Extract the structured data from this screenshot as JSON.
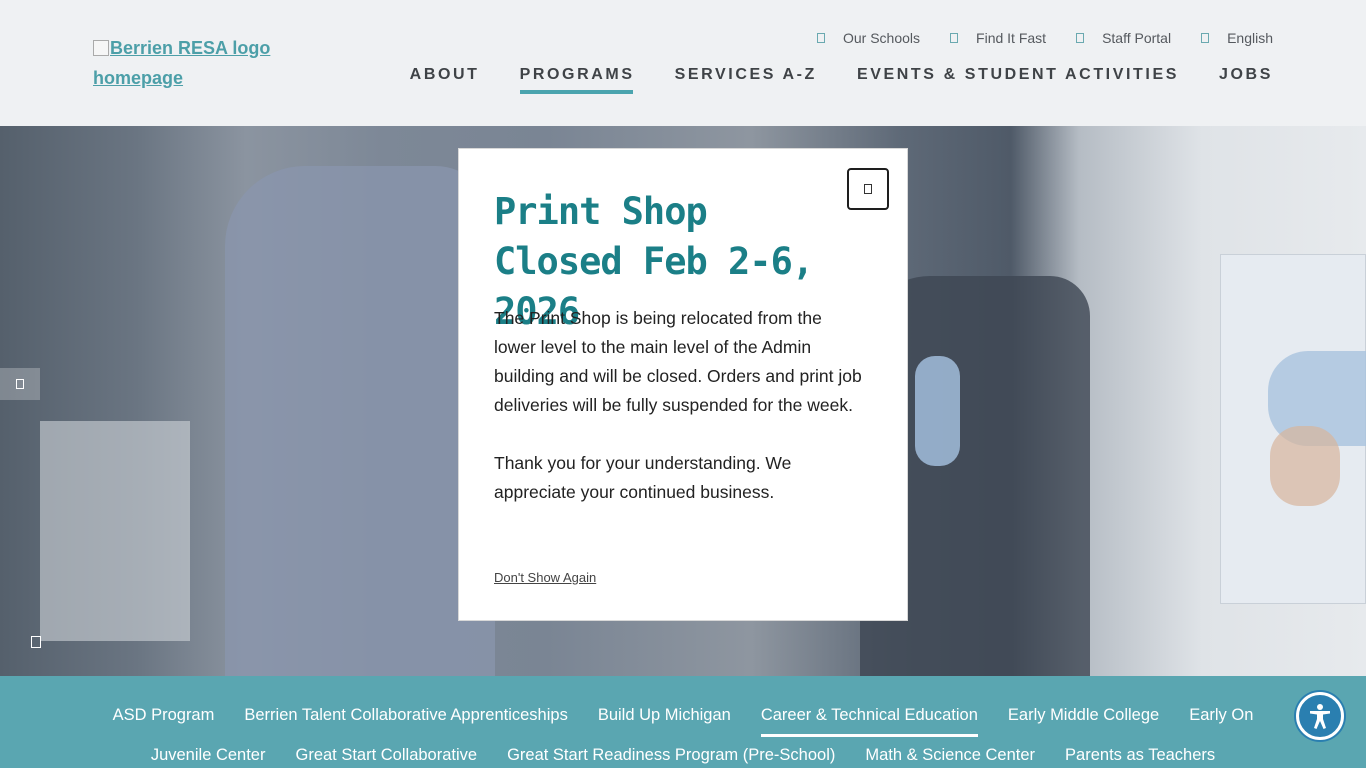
{
  "header": {
    "logo_alt": "Berrien RESA logo homepage",
    "utility_links": [
      {
        "label": "Our Schools",
        "icon": "school-icon"
      },
      {
        "label": "Find It Fast",
        "icon": "search-icon"
      },
      {
        "label": "Staff Portal",
        "icon": "lock-icon"
      },
      {
        "label": "English",
        "icon": "globe-icon"
      }
    ],
    "nav": [
      {
        "label": "ABOUT",
        "active": false
      },
      {
        "label": "PROGRAMS",
        "active": true
      },
      {
        "label": "SERVICES A-Z",
        "active": false
      },
      {
        "label": "EVENTS & STUDENT ACTIVITIES",
        "active": false
      },
      {
        "label": "JOBS",
        "active": false
      }
    ]
  },
  "modal": {
    "title": "Print Shop Closed Feb 2-6, 2026",
    "body_p1": "The Print Shop is being relocated from the lower level to the main level of the Admin building and will be closed. Orders and print job deliveries will be fully suspended for the week.",
    "body_p2": "Thank you for your understanding. We appreciate your continued business.",
    "dont_show": "Don't Show Again",
    "close_icon": "close-icon"
  },
  "programs": {
    "row1": [
      {
        "label": "ASD Program",
        "active": false
      },
      {
        "label": "Berrien Talent Collaborative Apprenticeships",
        "active": false
      },
      {
        "label": "Build Up Michigan",
        "active": false
      },
      {
        "label": "Career & Technical Education",
        "active": true
      },
      {
        "label": "Early Middle College",
        "active": false
      },
      {
        "label": "Early On",
        "active": false
      }
    ],
    "row2": [
      {
        "label": "Juvenile Center",
        "active": false
      },
      {
        "label": "Great Start Collaborative",
        "active": false
      },
      {
        "label": "Great Start Readiness Program (Pre-School)",
        "active": false
      },
      {
        "label": "Math & Science Center",
        "active": false
      },
      {
        "label": "Parents as Teachers",
        "active": false
      }
    ]
  },
  "colors": {
    "accent": "#4aa4ae",
    "title_teal": "#1b7f87",
    "program_bar": "#5aa6b1",
    "a11y_button": "#2a7fb0"
  }
}
